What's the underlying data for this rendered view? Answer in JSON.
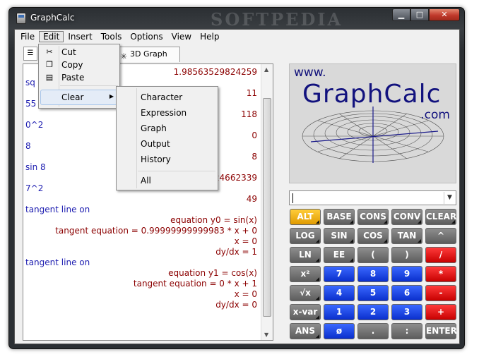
{
  "window": {
    "title": "GraphCalc",
    "watermark": "SOFTPEDIA",
    "buttons": [
      "minimize",
      "maximize",
      "close"
    ]
  },
  "menubar": [
    "File",
    "Edit",
    "Insert",
    "Tools",
    "Options",
    "View",
    "Help"
  ],
  "tabs": {
    "active": "3D Graph"
  },
  "edit_menu": {
    "items": [
      "Cut",
      "Copy",
      "Paste",
      "Clear"
    ]
  },
  "clear_menu": {
    "items": [
      "Character",
      "Expression",
      "Graph",
      "Output",
      "History",
      "All"
    ]
  },
  "output": {
    "lines": [
      {
        "type": "out",
        "text": "1.98563529824259"
      },
      {
        "type": "in",
        "text": "sq"
      },
      {
        "type": "out",
        "text": "11"
      },
      {
        "type": "in",
        "text": "55"
      },
      {
        "type": "out",
        "text": "118"
      },
      {
        "type": "in",
        "text": "0^2"
      },
      {
        "type": "out",
        "text": "0"
      },
      {
        "type": "in",
        "text": "8"
      },
      {
        "type": "out",
        "text": "8"
      },
      {
        "type": "in",
        "text": "sin 8"
      },
      {
        "type": "out",
        "text": "824662339"
      },
      {
        "type": "in",
        "text": "7^2"
      },
      {
        "type": "out",
        "text": "49"
      },
      {
        "type": "in",
        "text": "tangent line on"
      },
      {
        "type": "out",
        "text": "equation y0 = sin(x)"
      },
      {
        "type": "out",
        "text": "tangent equation = 0.99999999999983 * x + 0"
      },
      {
        "type": "out",
        "text": "x = 0"
      },
      {
        "type": "out",
        "text": "dy/dx = 1"
      },
      {
        "type": "in",
        "text": "tangent line on"
      },
      {
        "type": "out",
        "text": "equation y1 = cos(x)"
      },
      {
        "type": "out",
        "text": "tangent equation = 0 * x + 1"
      },
      {
        "type": "out",
        "text": "x = 0"
      },
      {
        "type": "out",
        "text": "dy/dx = 0"
      }
    ]
  },
  "logo": {
    "www": "www.",
    "name": "GraphCalc",
    "com": ".com"
  },
  "expression": {
    "value": ""
  },
  "keypad": [
    {
      "label": "ALT",
      "color": "orange",
      "sub": true
    },
    {
      "label": "BASE",
      "color": "gray",
      "sub": true
    },
    {
      "label": "CONS",
      "color": "gray",
      "sub": true
    },
    {
      "label": "CONV",
      "color": "gray",
      "sub": true
    },
    {
      "label": "CLEAR",
      "color": "gray",
      "sub": true
    },
    {
      "label": "LOG",
      "color": "gray",
      "sub": true
    },
    {
      "label": "SIN",
      "color": "gray",
      "sub": true
    },
    {
      "label": "COS",
      "color": "gray",
      "sub": true
    },
    {
      "label": "TAN",
      "color": "gray",
      "sub": true
    },
    {
      "label": "^",
      "color": "gray",
      "sub": false
    },
    {
      "label": "LN",
      "color": "gray",
      "sub": true
    },
    {
      "label": "EE",
      "color": "gray",
      "sub": true
    },
    {
      "label": "(",
      "color": "gray",
      "sub": false
    },
    {
      "label": ")",
      "color": "gray",
      "sub": false
    },
    {
      "label": "/",
      "color": "red",
      "sub": false
    },
    {
      "label": "x²",
      "color": "gray",
      "sub": true
    },
    {
      "label": "7",
      "color": "blue",
      "sub": false
    },
    {
      "label": "8",
      "color": "blue",
      "sub": false
    },
    {
      "label": "9",
      "color": "blue",
      "sub": false
    },
    {
      "label": "*",
      "color": "red",
      "sub": false
    },
    {
      "label": "√x",
      "color": "gray",
      "sub": true
    },
    {
      "label": "4",
      "color": "blue",
      "sub": false
    },
    {
      "label": "5",
      "color": "blue",
      "sub": false
    },
    {
      "label": "6",
      "color": "blue",
      "sub": false
    },
    {
      "label": "-",
      "color": "red",
      "sub": false
    },
    {
      "label": "x-var",
      "color": "gray",
      "sub": true
    },
    {
      "label": "1",
      "color": "blue",
      "sub": false
    },
    {
      "label": "2",
      "color": "blue",
      "sub": false
    },
    {
      "label": "3",
      "color": "blue",
      "sub": false
    },
    {
      "label": "+",
      "color": "red",
      "sub": false
    },
    {
      "label": "ANS",
      "color": "gray",
      "sub": true
    },
    {
      "label": "ø",
      "color": "blue",
      "sub": false
    },
    {
      "label": ".",
      "color": "gray",
      "sub": false
    },
    {
      "label": ":",
      "color": "gray",
      "sub": false
    },
    {
      "label": "ENTER",
      "color": "gray",
      "sub": false
    }
  ]
}
